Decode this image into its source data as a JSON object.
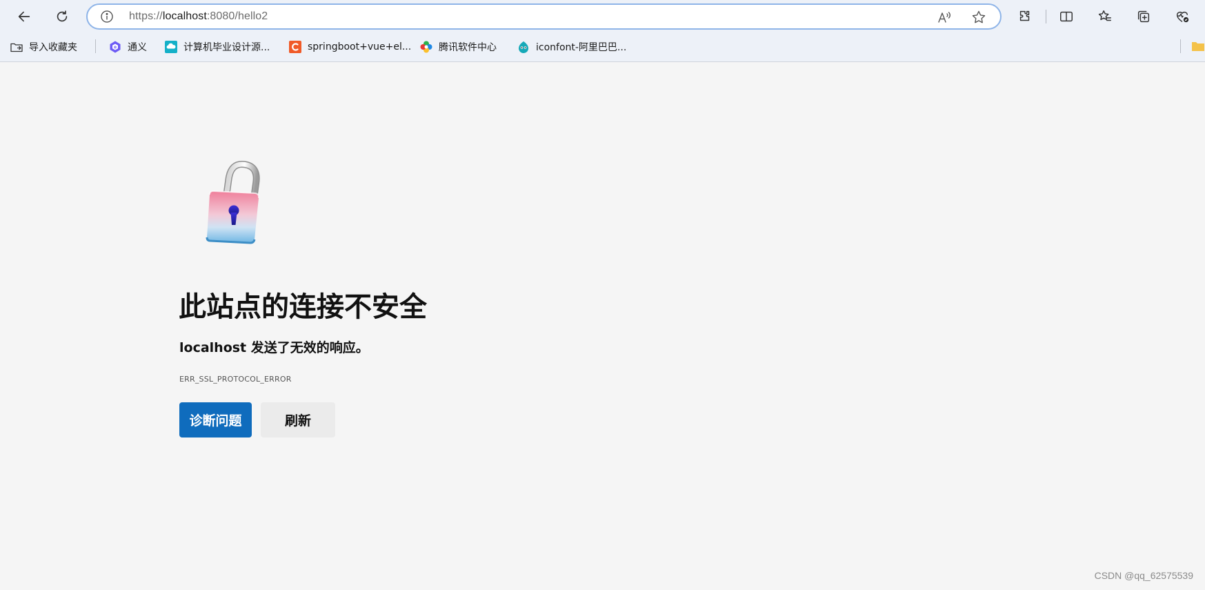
{
  "browser": {
    "url_prefix": "https://",
    "url_host": "localhost",
    "url_rest": ":8080/hello2",
    "icons": [
      "back-icon",
      "refresh-icon",
      "info-icon",
      "read-aloud-icon",
      "favorite-star-icon",
      "extensions-icon",
      "split-screen-icon",
      "favorites-icon",
      "collections-icon",
      "browser-essentials-icon"
    ]
  },
  "bookmarks": [
    {
      "label": "导入收藏夹",
      "icon": "import-favorites-icon"
    },
    {
      "label": "通义",
      "icon": "tongyi-icon"
    },
    {
      "label": "计算机毕业设计源...",
      "icon": "cloud-icon"
    },
    {
      "label": "springboot+vue+el...",
      "icon": "csdn-c-icon"
    },
    {
      "label": "腾讯软件中心",
      "icon": "tencent-icon"
    },
    {
      "label": "iconfont-阿里巴巴...",
      "icon": "iconfont-icon"
    }
  ],
  "error": {
    "title": "此站点的连接不安全",
    "message": "localhost 发送了无效的响应。",
    "code": "ERR_SSL_PROTOCOL_ERROR",
    "diagnose_label": "诊断问题",
    "refresh_label": "刷新"
  },
  "watermark": "CSDN @qq_62575539",
  "colors": {
    "primary_button": "#0f6cbd",
    "page_background": "#f5f5f5",
    "toolbar_background": "#edf1f8"
  }
}
